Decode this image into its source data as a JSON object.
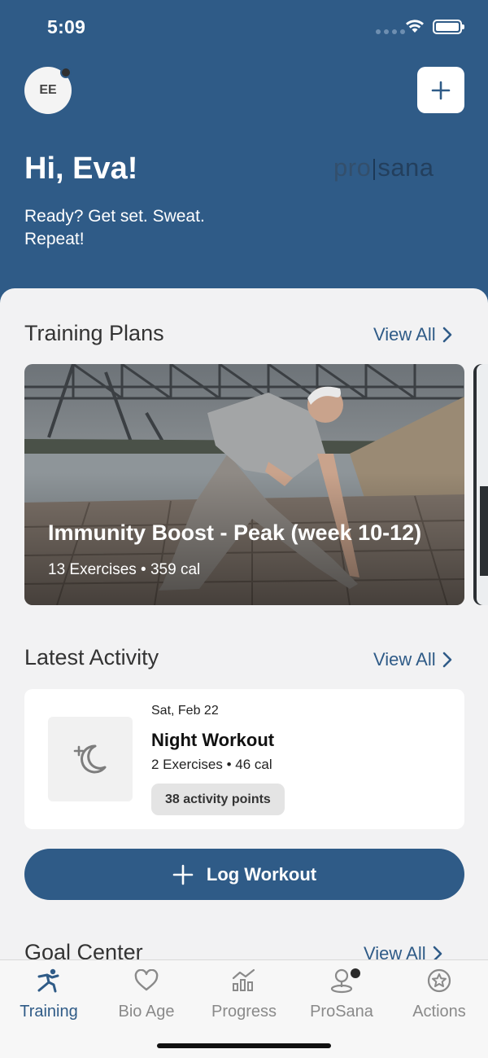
{
  "status_bar": {
    "time": "5:09"
  },
  "header": {
    "avatar_initials": "EE",
    "greeting": "Hi, Eva!",
    "subtitle": "Ready? Get set. Sweat. Repeat!",
    "logo_left": "pro",
    "logo_right": "sana"
  },
  "training_plans": {
    "title": "Training Plans",
    "view_all": "View All",
    "card": {
      "title": "Immunity Boost - Peak (week 10-12)",
      "meta": "13 Exercises • 359 cal"
    }
  },
  "latest_activity": {
    "title": "Latest Activity",
    "view_all": "View All",
    "item": {
      "date": "Sat, Feb 22",
      "name": "Night Workout",
      "meta": "2 Exercises • 46 cal",
      "points": "38 activity points",
      "icon": "moon-plus-icon"
    }
  },
  "log_workout": {
    "label": "Log Workout"
  },
  "goal_center": {
    "title": "Goal Center",
    "view_all": "View All"
  },
  "tabs": [
    {
      "label": "Training",
      "icon": "runner-icon",
      "active": true
    },
    {
      "label": "Bio Age",
      "icon": "heart-icon",
      "active": false
    },
    {
      "label": "Progress",
      "icon": "bar-chart-icon",
      "active": false
    },
    {
      "label": "ProSana",
      "icon": "map-pin-icon",
      "active": false
    },
    {
      "label": "Actions",
      "icon": "star-circle-icon",
      "active": false
    }
  ],
  "colors": {
    "brand": "#2f5b87",
    "background": "#f2f2f3"
  }
}
